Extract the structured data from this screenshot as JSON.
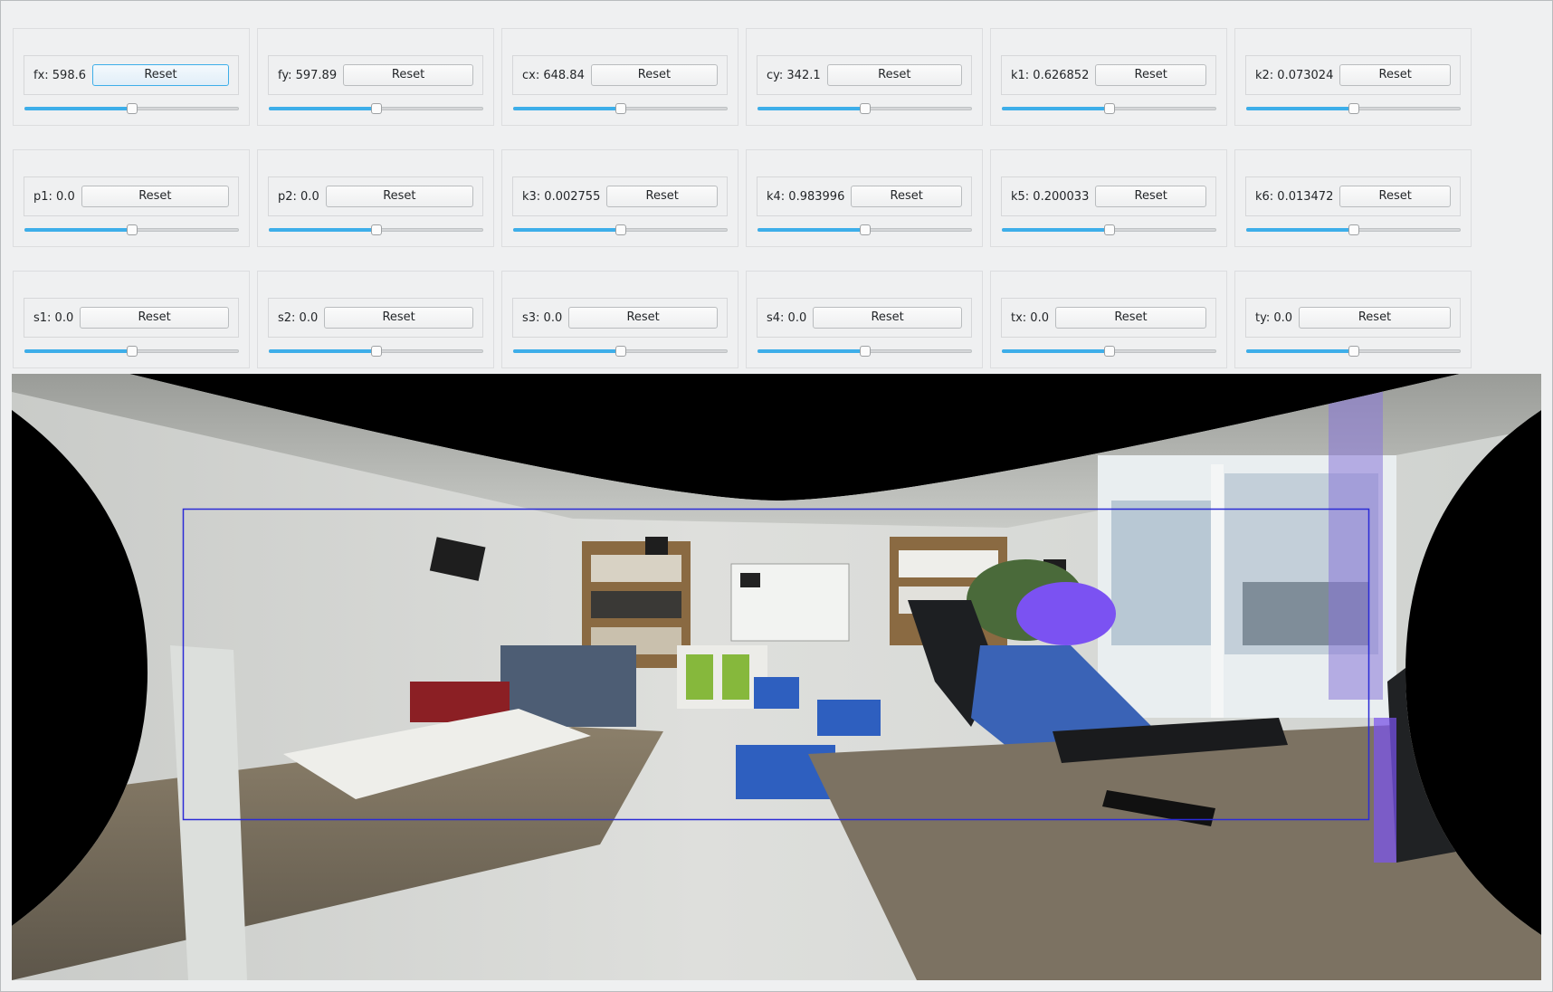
{
  "button_label": "Reset",
  "controls": [
    {
      "label": "fx: 598.6",
      "slider_fraction": 0.5,
      "focused": true
    },
    {
      "label": "fy: 597.89",
      "slider_fraction": 0.5
    },
    {
      "label": "cx: 648.84",
      "slider_fraction": 0.5
    },
    {
      "label": "cy: 342.1",
      "slider_fraction": 0.5
    },
    {
      "label": "k1: 0.626852",
      "slider_fraction": 0.5
    },
    {
      "label": "k2: 0.073024",
      "slider_fraction": 0.5
    },
    {
      "label": "p1: 0.0",
      "slider_fraction": 0.5
    },
    {
      "label": "p2: 0.0",
      "slider_fraction": 0.5
    },
    {
      "label": "k3: 0.002755",
      "slider_fraction": 0.5
    },
    {
      "label": "k4: 0.983996",
      "slider_fraction": 0.5
    },
    {
      "label": "k5: 0.200033",
      "slider_fraction": 0.5
    },
    {
      "label": "k6: 0.013472",
      "slider_fraction": 0.5
    },
    {
      "label": "s1: 0.0",
      "slider_fraction": 0.5
    },
    {
      "label": "s2: 0.0",
      "slider_fraction": 0.5
    },
    {
      "label": "s3: 0.0",
      "slider_fraction": 0.5
    },
    {
      "label": "s4: 0.0",
      "slider_fraction": 0.5
    },
    {
      "label": "tx: 0.0",
      "slider_fraction": 0.5
    },
    {
      "label": "ty: 0.0",
      "slider_fraction": 0.5
    }
  ],
  "colors": {
    "accent": "#3daee9",
    "roi_rect": "#2b2bd6",
    "background": "#eff0f1"
  }
}
